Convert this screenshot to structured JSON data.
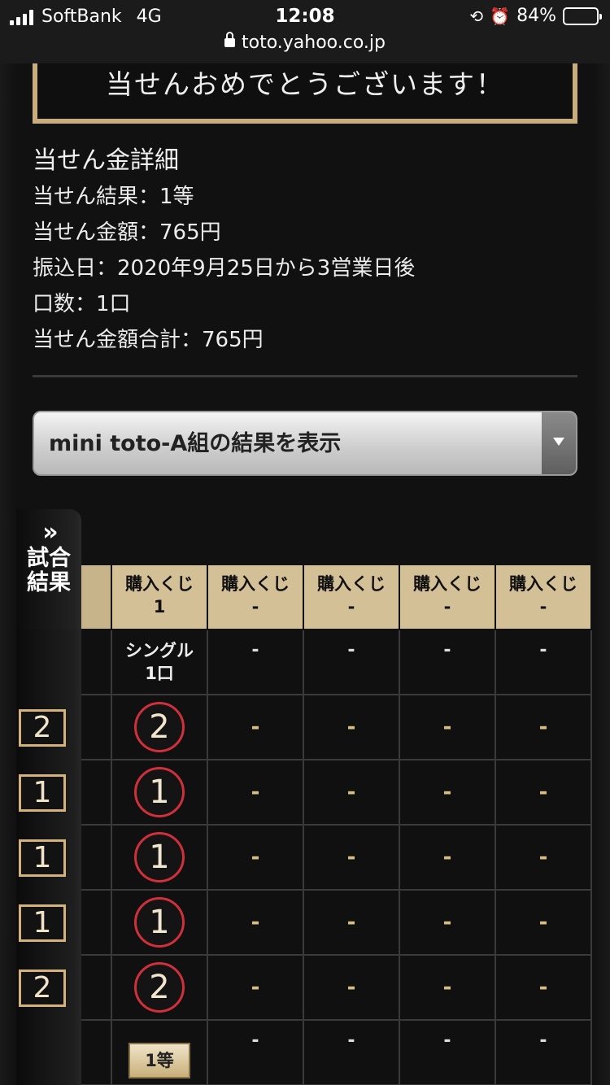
{
  "status_bar": {
    "carrier": "SoftBank",
    "network": "4G",
    "time": "12:08",
    "battery": "84%",
    "battery_level": 0.84,
    "url": "toto.yahoo.co.jp"
  },
  "banner": {
    "text": "当せんおめでとうございます！"
  },
  "details": {
    "heading": "当せん金詳細",
    "result": "当せん結果：1等",
    "amount": "当せん金額：765円",
    "transfer": "振込日：2020年9月25日から3営業日後",
    "units": "口数：1口",
    "total": "当せん金額合計：765円"
  },
  "select": {
    "value": "mini toto-A組の結果を表示"
  },
  "side_tab": {
    "chevrons": "»",
    "line1": "試合",
    "line2": "結果"
  },
  "table": {
    "headers": [
      {
        "line1": "購入くじ",
        "line2": "1"
      },
      {
        "line1": "購入くじ",
        "line2": "-"
      },
      {
        "line1": "購入くじ",
        "line2": "-"
      },
      {
        "line1": "購入くじ",
        "line2": "-"
      },
      {
        "line1": "購入くじ",
        "line2": "-"
      }
    ],
    "type_row": {
      "col1_line1": "シングル",
      "col1_line2": "1口",
      "other": "-"
    },
    "matches": [
      {
        "result": "2",
        "pick": "2"
      },
      {
        "result": "1",
        "pick": "1"
      },
      {
        "result": "1",
        "pick": "1"
      },
      {
        "result": "1",
        "pick": "1"
      },
      {
        "result": "2",
        "pick": "2"
      }
    ],
    "dash": "-",
    "prize_label": "1等"
  },
  "colors": {
    "gold": "#c9ad7e",
    "red_circle": "#d0303a",
    "header_bg": "#d4c097"
  }
}
